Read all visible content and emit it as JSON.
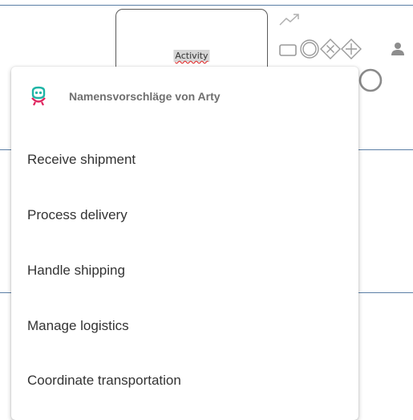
{
  "canvas": {
    "activity": {
      "label": "Activity"
    }
  },
  "palette": {
    "icons": [
      "connector-arrow-icon",
      "task-rectangle-icon",
      "event-circle-icon",
      "exclusive-gateway-icon",
      "parallel-gateway-icon",
      "person-icon",
      "end-event-icon"
    ],
    "color": "#a8a8a8"
  },
  "suggestions": {
    "header": "Namensvorschläge von Arty",
    "items": [
      {
        "label": "Receive shipment"
      },
      {
        "label": "Process delivery"
      },
      {
        "label": "Handle shipping"
      },
      {
        "label": "Manage logistics"
      },
      {
        "label": "Coordinate transportation"
      }
    ]
  },
  "colors": {
    "lane_line": "#5b7fa6",
    "arty_teal": "#1fb5a6",
    "arty_pink": "#e0245e"
  }
}
